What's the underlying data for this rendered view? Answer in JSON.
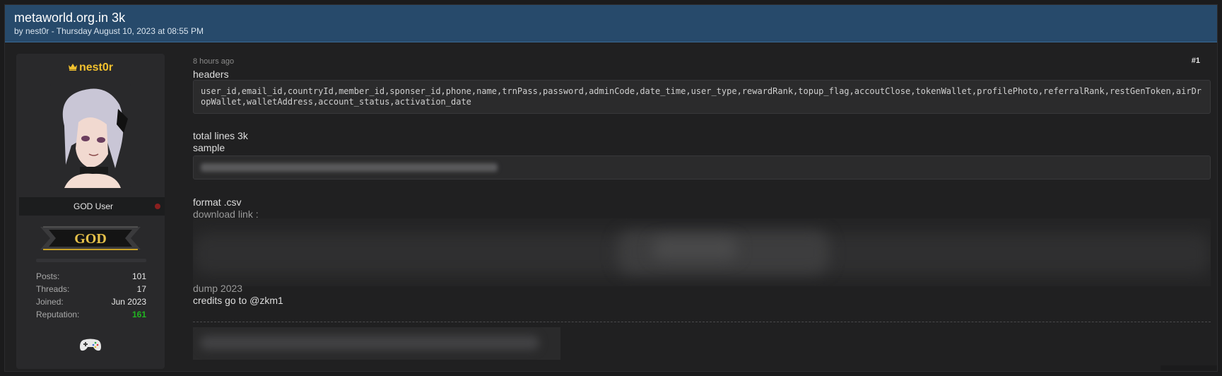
{
  "thread": {
    "title": "metaworld.org.in 3k",
    "meta": "by nest0r - Thursday August 10, 2023 at 08:55 PM"
  },
  "user": {
    "name": "nest0r",
    "crown_icon": "crown-icon",
    "rank_title": "GOD User",
    "badge_text": "GOD",
    "stats": [
      {
        "label": "Posts:",
        "value": "101"
      },
      {
        "label": "Threads:",
        "value": "17"
      },
      {
        "label": "Joined:",
        "value": "Jun 2023"
      },
      {
        "label": "Reputation:",
        "value": "161"
      }
    ],
    "status_color": "#8a1f1f",
    "reputation_color": "#21b521"
  },
  "post": {
    "time": "8 hours ago",
    "number": "#1",
    "headers_label": "headers",
    "headers_code": "user_id,email_id,countryId,member_id,sponser_id,phone,name,trnPass,password,adminCode,date_time,user_type,rewardRank,topup_flag,accoutClose,tokenWallet,profilePhoto,referralRank,restGenToken,airDropWallet,walletAddress,account_status,activation_date",
    "total_lines": "total lines 3k",
    "sample_label": "sample",
    "format_label": "format .csv",
    "download_label": "download link :",
    "dump_label": "dump 2023",
    "credits": "credits go to @zkm1"
  },
  "colors": {
    "header_bg": "#274a6b",
    "username": "#f2c12e"
  }
}
